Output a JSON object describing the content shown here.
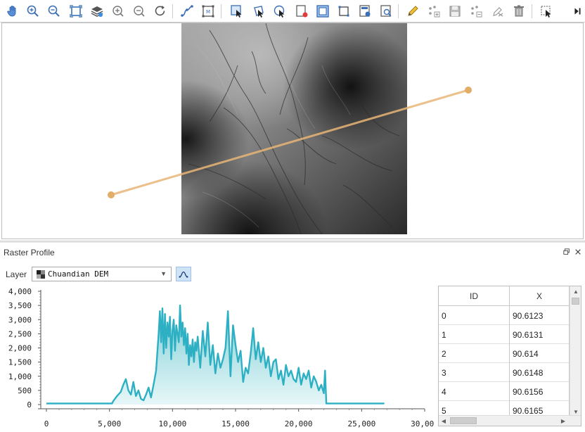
{
  "toolbar": {
    "buttons": [
      "pan-hand-icon",
      "zoom-in-icon",
      "zoom-out-icon",
      "full-extent-icon",
      "layers-icon",
      "zoom-in-fixed-icon",
      "zoom-out-fixed-icon",
      "refresh-icon",
      "measure-line-icon",
      "select-frame-icon",
      "select-feature-icon",
      "select-by-polygon-icon",
      "select-by-circle-icon",
      "clear-selection-icon",
      "new-layer-icon",
      "rectangle-tool-icon",
      "layer-attributes-icon",
      "identify-icon",
      "edit-pencil-icon",
      "add-vertex-icon",
      "save-edits-icon",
      "delete-vertex-icon",
      "undo-edit-icon",
      "delete-icon",
      "pointer-select-icon",
      "overflow-arrow-icon"
    ]
  },
  "panel": {
    "title": "Raster Profile",
    "restore_icon": "restore-icon",
    "close_icon": "close-icon"
  },
  "layer": {
    "label": "Layer",
    "selected": "Chuandian DEM"
  },
  "colors": {
    "profile_line": "#e7b575",
    "series_line": "#2db0c3",
    "series_fill_top": "#6fc9d2",
    "series_fill_bottom": "#e4f6f7",
    "selected_button": "#cfe3f7"
  },
  "chart_data": {
    "type": "area",
    "xlim": [
      0,
      30000
    ],
    "ylim": [
      0,
      4000
    ],
    "x_ticks": [
      "0",
      "5,000",
      "10,000",
      "15,000",
      "20,000",
      "25,000",
      "30,000"
    ],
    "y_ticks": [
      "0",
      "500",
      "1,000",
      "1,500",
      "2,000",
      "2,500",
      "3,000",
      "3,500",
      "4,000"
    ],
    "series": [
      {
        "x": [
          0,
          5200,
          5300,
          5600,
          5900,
          6100,
          6300,
          6500,
          6700,
          6900,
          7100,
          7300,
          7500,
          7700,
          7900,
          8100,
          8300,
          8500,
          8700,
          8900,
          9000,
          9100,
          9200,
          9300,
          9400,
          9500,
          9600,
          9700,
          9800,
          9900,
          10000,
          10100,
          10200,
          10300,
          10400,
          10500,
          10600,
          10700,
          10800,
          10900,
          11000,
          11100,
          11200,
          11300,
          11400,
          11500,
          11600,
          11700,
          11800,
          11900,
          12000,
          12200,
          12400,
          12600,
          12800,
          13000,
          13200,
          13400,
          13600,
          13800,
          14000,
          14200,
          14400,
          14600,
          14800,
          15000,
          15200,
          15400,
          15600,
          15800,
          16000,
          16200,
          16400,
          16600,
          16800,
          17000,
          17200,
          17400,
          17600,
          17800,
          18000,
          18200,
          18400,
          18600,
          18800,
          19000,
          19200,
          19400,
          19600,
          19800,
          20000,
          20200,
          20400,
          20600,
          20800,
          21000,
          21200,
          21400,
          21600,
          21800,
          22000,
          22100,
          22200,
          26800
        ],
        "y": [
          40,
          40,
          120,
          300,
          450,
          700,
          900,
          500,
          350,
          800,
          300,
          500,
          200,
          150,
          350,
          600,
          250,
          700,
          1200,
          2500,
          3300,
          2200,
          3400,
          1800,
          3200,
          2000,
          2900,
          2400,
          3100,
          1600,
          2600,
          3000,
          1900,
          2800,
          2500,
          2200,
          3500,
          2400,
          2900,
          2100,
          2700,
          1800,
          2500,
          1400,
          2100,
          1700,
          2300,
          1500,
          2200,
          1900,
          2400,
          1300,
          2600,
          1700,
          2900,
          1400,
          2100,
          1100,
          1800,
          1300,
          1600,
          2000,
          3300,
          1000,
          2800,
          2100,
          1500,
          1900,
          800,
          1300,
          1100,
          1800,
          2700,
          1600,
          2200,
          1500,
          2000,
          1300,
          1700,
          1000,
          1500,
          1600,
          900,
          1200,
          700,
          1400,
          1000,
          1200,
          900,
          800,
          1300,
          700,
          1100,
          900,
          1200,
          600,
          1000,
          800,
          500,
          700,
          400,
          1200,
          40,
          40
        ]
      }
    ]
  },
  "table": {
    "headers": [
      "ID",
      "X"
    ],
    "rows": [
      [
        "0",
        "90.6123"
      ],
      [
        "1",
        "90.6131"
      ],
      [
        "2",
        "90.614"
      ],
      [
        "3",
        "90.6148"
      ],
      [
        "4",
        "90.6156"
      ],
      [
        "5",
        "90.6165"
      ]
    ]
  }
}
